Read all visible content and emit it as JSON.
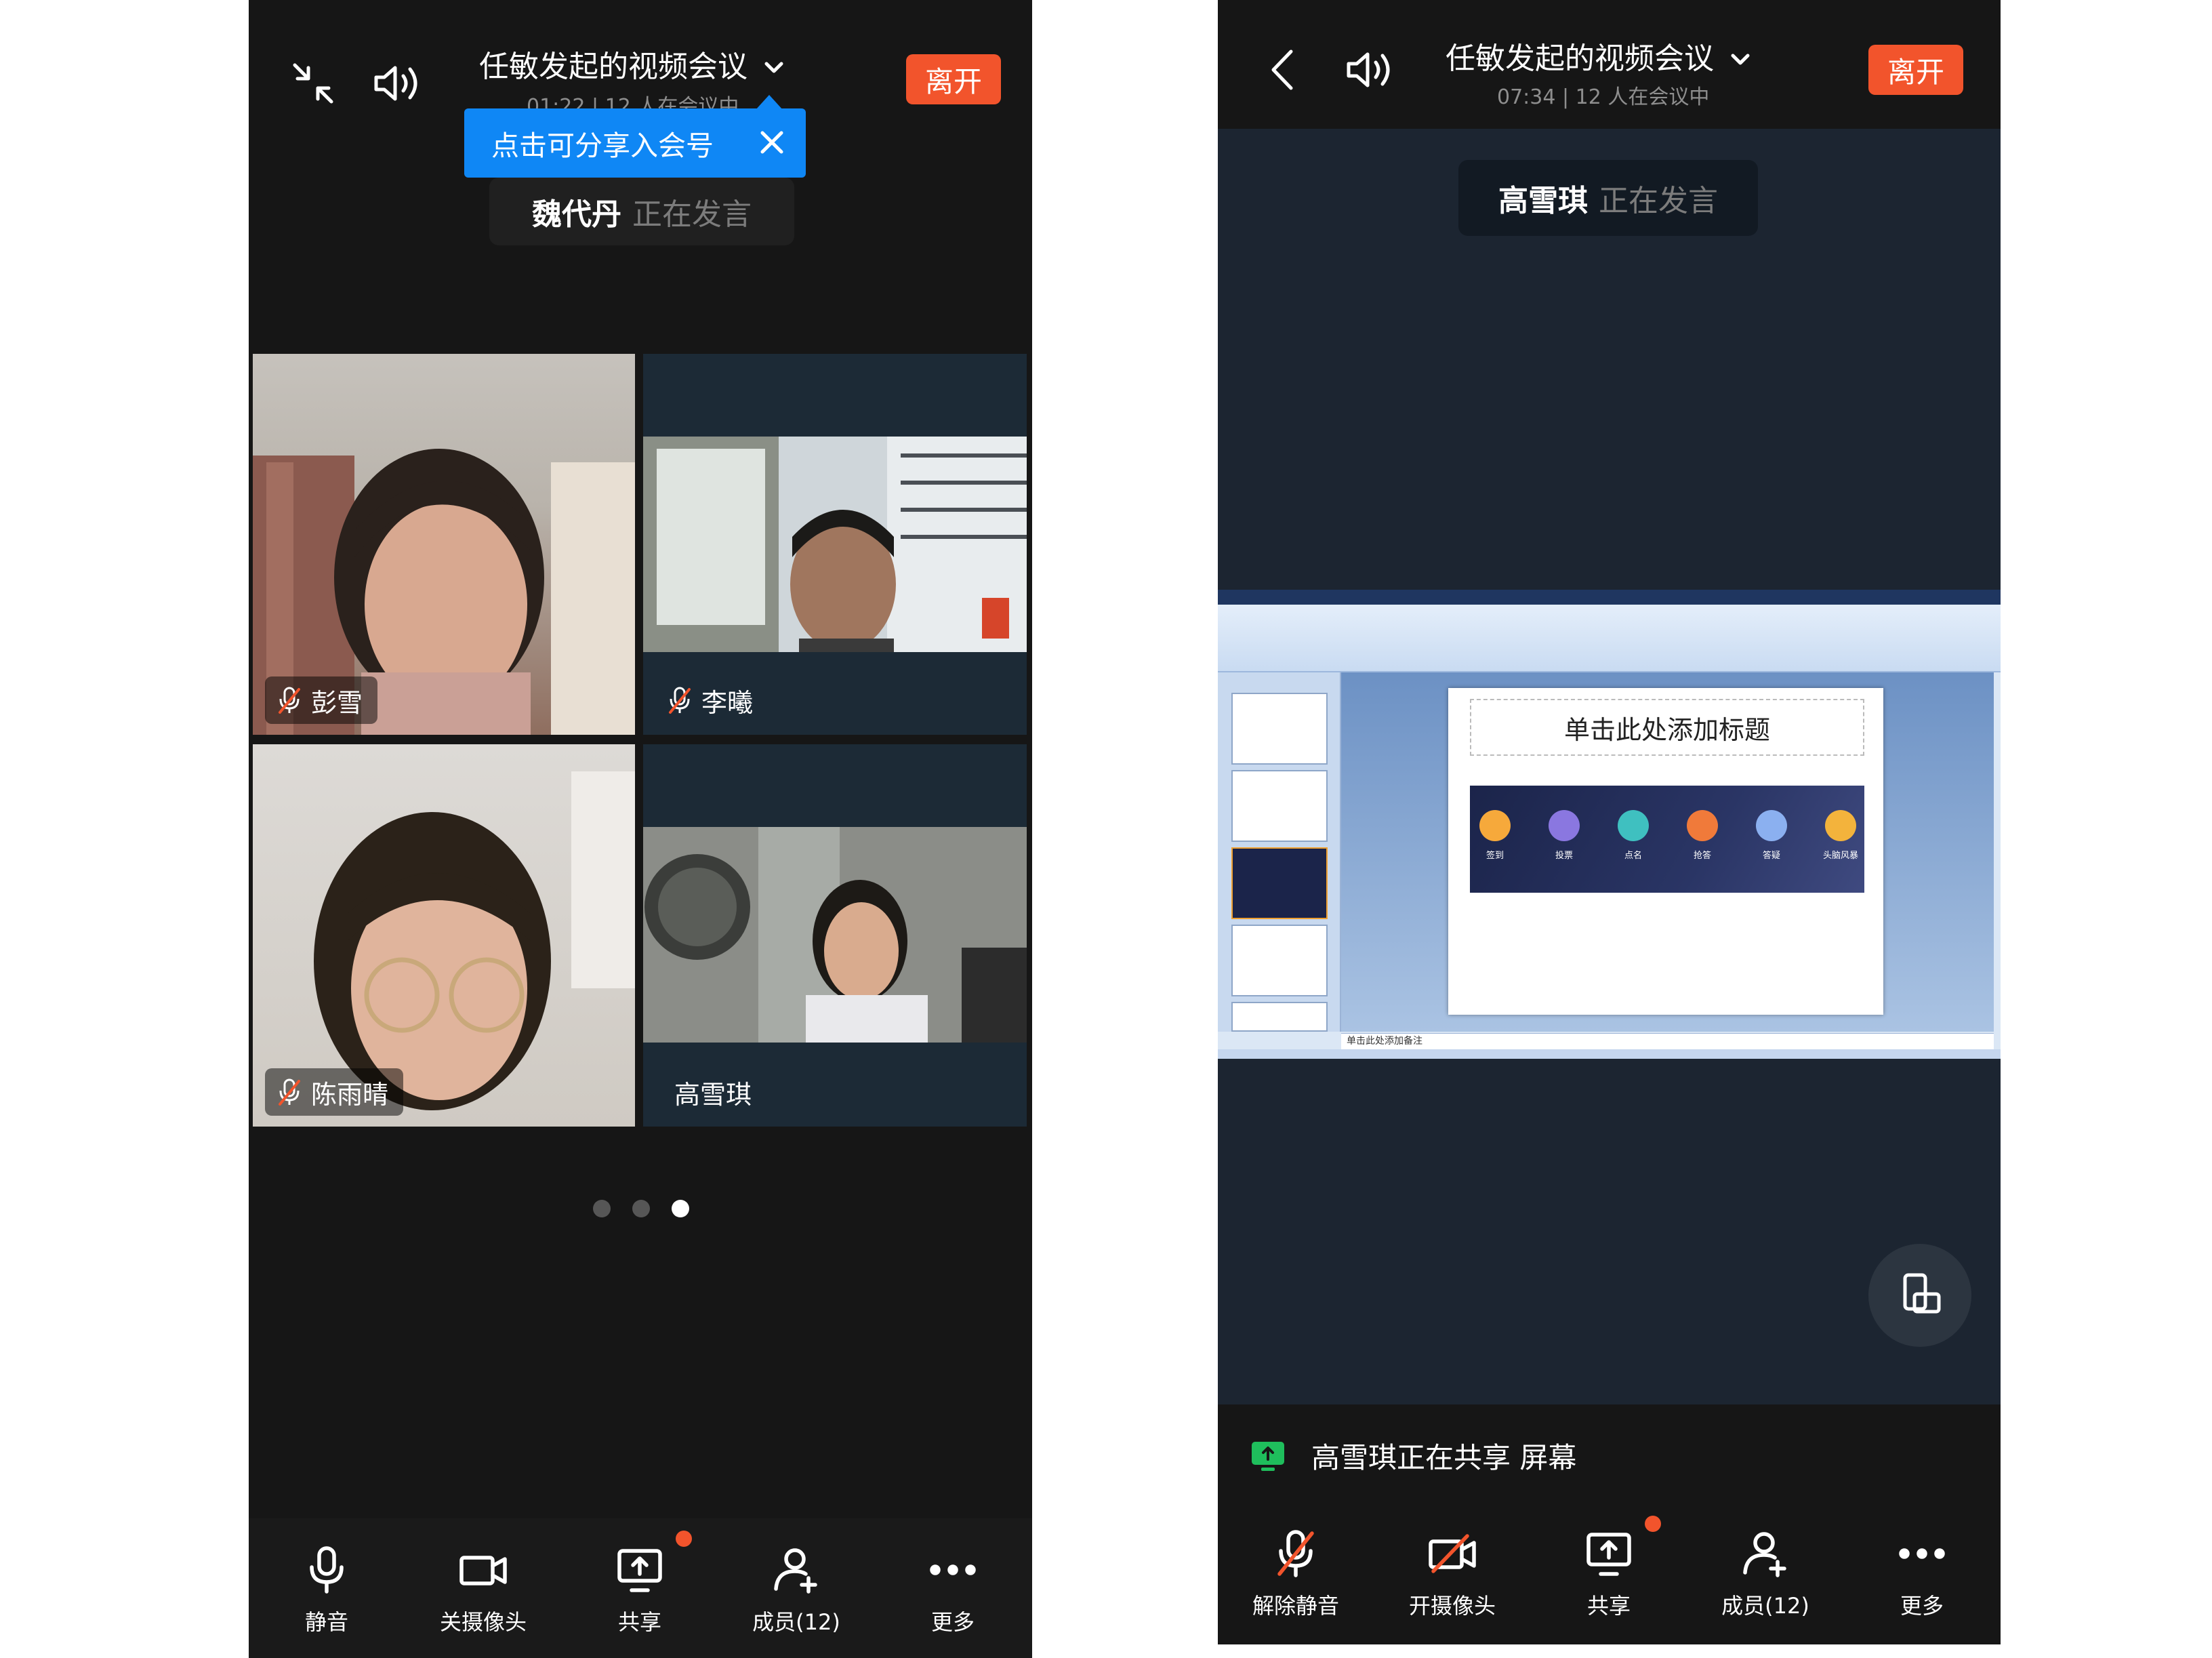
{
  "left": {
    "header": {
      "title": "任敏发起的视频会议",
      "subline": "01:22 | 12 人在会议中",
      "leave_label": "离开"
    },
    "tooltip": {
      "text": "点击可分享入会号"
    },
    "speaker": {
      "name": "魏代丹",
      "status": "正在发言"
    },
    "tiles": [
      {
        "name": "彭雪",
        "muted": true
      },
      {
        "name": "李曦",
        "muted": true
      },
      {
        "name": "陈雨晴",
        "muted": true
      },
      {
        "name": "高雪琪",
        "muted": false
      }
    ],
    "pager": {
      "pages": 3,
      "active": 3
    },
    "toolbar": {
      "mute_label": "静音",
      "camera_label": "关摄像头",
      "share_label": "共享",
      "members_label": "成员(12)",
      "more_label": "更多"
    }
  },
  "right": {
    "header": {
      "title": "任敏发起的视频会议",
      "subline": "07:34 | 12 人在会议中",
      "leave_label": "离开"
    },
    "speaker": {
      "name": "高雪琪",
      "status": "正在发言"
    },
    "slide": {
      "title": "单击此处添加标题",
      "notes": "单击此处添加备注",
      "icon_labels": [
        "签到",
        "投票",
        "点名",
        "抢答",
        "答疑",
        "头脑风暴"
      ],
      "icon_colors": [
        "#f6a93b",
        "#8a77e0",
        "#3fc0c0",
        "#f07a3a",
        "#8bb0f0",
        "#f3b33c"
      ]
    },
    "share_status": "高雪琪正在共享 屏幕",
    "toolbar": {
      "unmute_label": "解除静音",
      "camera_label": "开摄像头",
      "share_label": "共享",
      "members_label": "成员(12)",
      "more_label": "更多"
    }
  },
  "colors": {
    "accent_red": "#f2542c",
    "tooltip_blue": "#0f87f5",
    "share_green": "#1fbe5c"
  }
}
